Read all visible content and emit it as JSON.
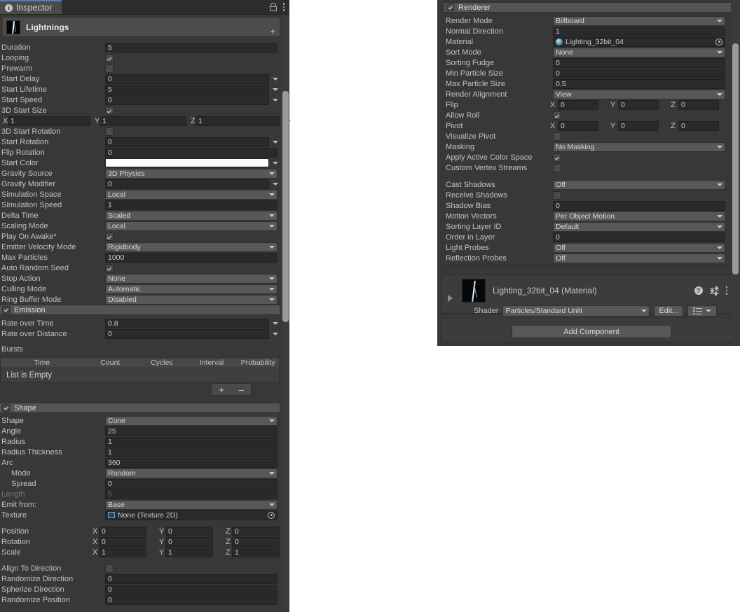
{
  "window": {
    "tab_label": "Inspector",
    "icons": {
      "info": "info-icon",
      "lock": "lock-icon",
      "menu": "kebab-menu-icon"
    }
  },
  "object_header": {
    "name": "Lightnings",
    "add_glyph": "+"
  },
  "particle_system": {
    "main": [
      {
        "label": "Duration",
        "type": "field",
        "value": "5"
      },
      {
        "label": "Looping",
        "type": "check",
        "value": true
      },
      {
        "label": "Prewarm",
        "type": "check",
        "value": false
      },
      {
        "label": "Start Delay",
        "type": "field",
        "value": "0",
        "arrow": true
      },
      {
        "label": "Start Lifetime",
        "type": "field",
        "value": "5",
        "arrow": true
      },
      {
        "label": "Start Speed",
        "type": "field",
        "value": "0",
        "arrow": true
      },
      {
        "label": "3D Start Size",
        "type": "check",
        "value": true
      },
      {
        "label": "",
        "type": "vec3",
        "x": "1",
        "y": "1",
        "z": "1",
        "arrow": true
      },
      {
        "label": "3D Start Rotation",
        "type": "check",
        "value": false
      },
      {
        "label": "Start Rotation",
        "type": "field",
        "value": "0",
        "arrow": true
      },
      {
        "label": "Flip Rotation",
        "type": "field",
        "value": "0"
      },
      {
        "label": "Start Color",
        "type": "color",
        "value": "#ffffff",
        "arrow": true
      },
      {
        "label": "Gravity Source",
        "type": "popup",
        "value": "3D Physics"
      },
      {
        "label": "Gravity Modifier",
        "type": "field",
        "value": "0",
        "arrow": true
      },
      {
        "label": "Simulation Space",
        "type": "popup",
        "value": "Local"
      },
      {
        "label": "Simulation Speed",
        "type": "field",
        "value": "1"
      },
      {
        "label": "Delta Time",
        "type": "popup",
        "value": "Scaled"
      },
      {
        "label": "Scaling Mode",
        "type": "popup",
        "value": "Local"
      },
      {
        "label": "Play On Awake*",
        "type": "check",
        "value": true
      },
      {
        "label": "Emitter Velocity Mode",
        "type": "popup",
        "value": "Rigidbody"
      },
      {
        "label": "Max Particles",
        "type": "field",
        "value": "1000"
      },
      {
        "label": "Auto Random Seed",
        "type": "check",
        "value": true
      },
      {
        "label": "Stop Action",
        "type": "popup",
        "value": "None"
      },
      {
        "label": "Culling Mode",
        "type": "popup",
        "value": "Automatic"
      },
      {
        "label": "Ring Buffer Mode",
        "type": "popup",
        "value": "Disabled"
      }
    ],
    "emission": {
      "title": "Emission",
      "enabled": true,
      "rows": [
        {
          "label": "Rate over Time",
          "type": "field",
          "value": "0.8",
          "arrow": true
        },
        {
          "label": "Rate over Distance",
          "type": "field",
          "value": "0",
          "arrow": true
        }
      ],
      "bursts_label": "Bursts",
      "bursts_columns": [
        "Time",
        "Count",
        "Cycles",
        "Interval",
        "Probability"
      ],
      "bursts_empty_text": "List is Empty",
      "add_label": "+",
      "remove_label": "–"
    },
    "shape": {
      "title": "Shape",
      "enabled": true,
      "rows": [
        {
          "label": "Shape",
          "type": "popup",
          "value": "Cone"
        },
        {
          "label": "Angle",
          "type": "field",
          "value": "25"
        },
        {
          "label": "Radius",
          "type": "field",
          "value": "1"
        },
        {
          "label": "Radius Thickness",
          "type": "field",
          "value": "1"
        },
        {
          "label": "Arc",
          "type": "field",
          "value": "360"
        },
        {
          "label": "Mode",
          "type": "popup",
          "value": "Random",
          "indent": true
        },
        {
          "label": "Spread",
          "type": "field",
          "value": "0",
          "indent": true
        },
        {
          "label": "Length",
          "type": "field",
          "value": "5",
          "disabled": true
        },
        {
          "label": "Emit from:",
          "type": "popup",
          "value": "Base"
        },
        {
          "label": "Texture",
          "type": "objref",
          "value": "None (Texture 2D)",
          "icon": "texture2d-icon"
        }
      ],
      "transform": [
        {
          "label": "Position",
          "x": "0",
          "y": "0",
          "z": "0"
        },
        {
          "label": "Rotation",
          "x": "0",
          "y": "0",
          "z": "0"
        },
        {
          "label": "Scale",
          "x": "1",
          "y": "1",
          "z": "1"
        }
      ],
      "tail": [
        {
          "label": "Align To Direction",
          "type": "check",
          "value": false
        },
        {
          "label": "Randomize Direction",
          "type": "field",
          "value": "0"
        },
        {
          "label": "Spherize Direction",
          "type": "field",
          "value": "0"
        },
        {
          "label": "Randomize Position",
          "type": "field",
          "value": "0"
        }
      ]
    }
  },
  "renderer": {
    "title": "Renderer",
    "enabled": true,
    "rows": [
      {
        "label": "Render Mode",
        "type": "popup",
        "value": "Billboard"
      },
      {
        "label": "Normal Direction",
        "type": "field",
        "value": "1"
      },
      {
        "label": "Material",
        "type": "objref",
        "value": "Lighting_32bit_04",
        "icon": "material-sphere-icon"
      },
      {
        "label": "Sort Mode",
        "type": "popup",
        "value": "None"
      },
      {
        "label": "Sorting Fudge",
        "type": "field",
        "value": "0"
      },
      {
        "label": "Min Particle Size",
        "type": "field",
        "value": "0"
      },
      {
        "label": "Max Particle Size",
        "type": "field",
        "value": "0.5"
      },
      {
        "label": "Render Alignment",
        "type": "popup",
        "value": "View"
      },
      {
        "label": "Flip",
        "type": "vec3",
        "x": "0",
        "y": "0",
        "z": "0"
      },
      {
        "label": "Allow Roll",
        "type": "check",
        "value": true
      },
      {
        "label": "Pivot",
        "type": "vec3",
        "x": "0",
        "y": "0",
        "z": "0"
      },
      {
        "label": "Visualize Pivot",
        "type": "check",
        "value": false
      },
      {
        "label": "Masking",
        "type": "popup",
        "value": "No Masking"
      },
      {
        "label": "Apply Active Color Space",
        "type": "check",
        "value": true
      },
      {
        "label": "Custom Vertex Streams",
        "type": "check",
        "value": false
      },
      {
        "label": "",
        "type": "gap"
      },
      {
        "label": "Cast Shadows",
        "type": "popup",
        "value": "Off"
      },
      {
        "label": "Receive Shadows",
        "type": "check",
        "value": false
      },
      {
        "label": "Shadow Bias",
        "type": "field",
        "value": "0"
      },
      {
        "label": "Motion Vectors",
        "type": "popup",
        "value": "Per Object Motion"
      },
      {
        "label": "Sorting Layer ID",
        "type": "popup",
        "value": "Default"
      },
      {
        "label": "Order in Layer",
        "type": "field",
        "value": "0"
      },
      {
        "label": "Light Probes",
        "type": "popup",
        "value": "Off"
      },
      {
        "label": "Reflection Probes",
        "type": "popup",
        "value": "Off"
      }
    ]
  },
  "material_card": {
    "title": "Lighting_32bit_04 (Material)",
    "shader_label": "Shader",
    "shader_value": "Particles/Standard Unlit",
    "edit_label": "Edit...",
    "icons": {
      "help": "help-icon",
      "settings": "settings-sliders-icon",
      "menu": "kebab-menu-icon",
      "preset": "preset-icon",
      "expand": "expand-triangle-icon"
    }
  },
  "add_component": {
    "label": "Add Component"
  }
}
